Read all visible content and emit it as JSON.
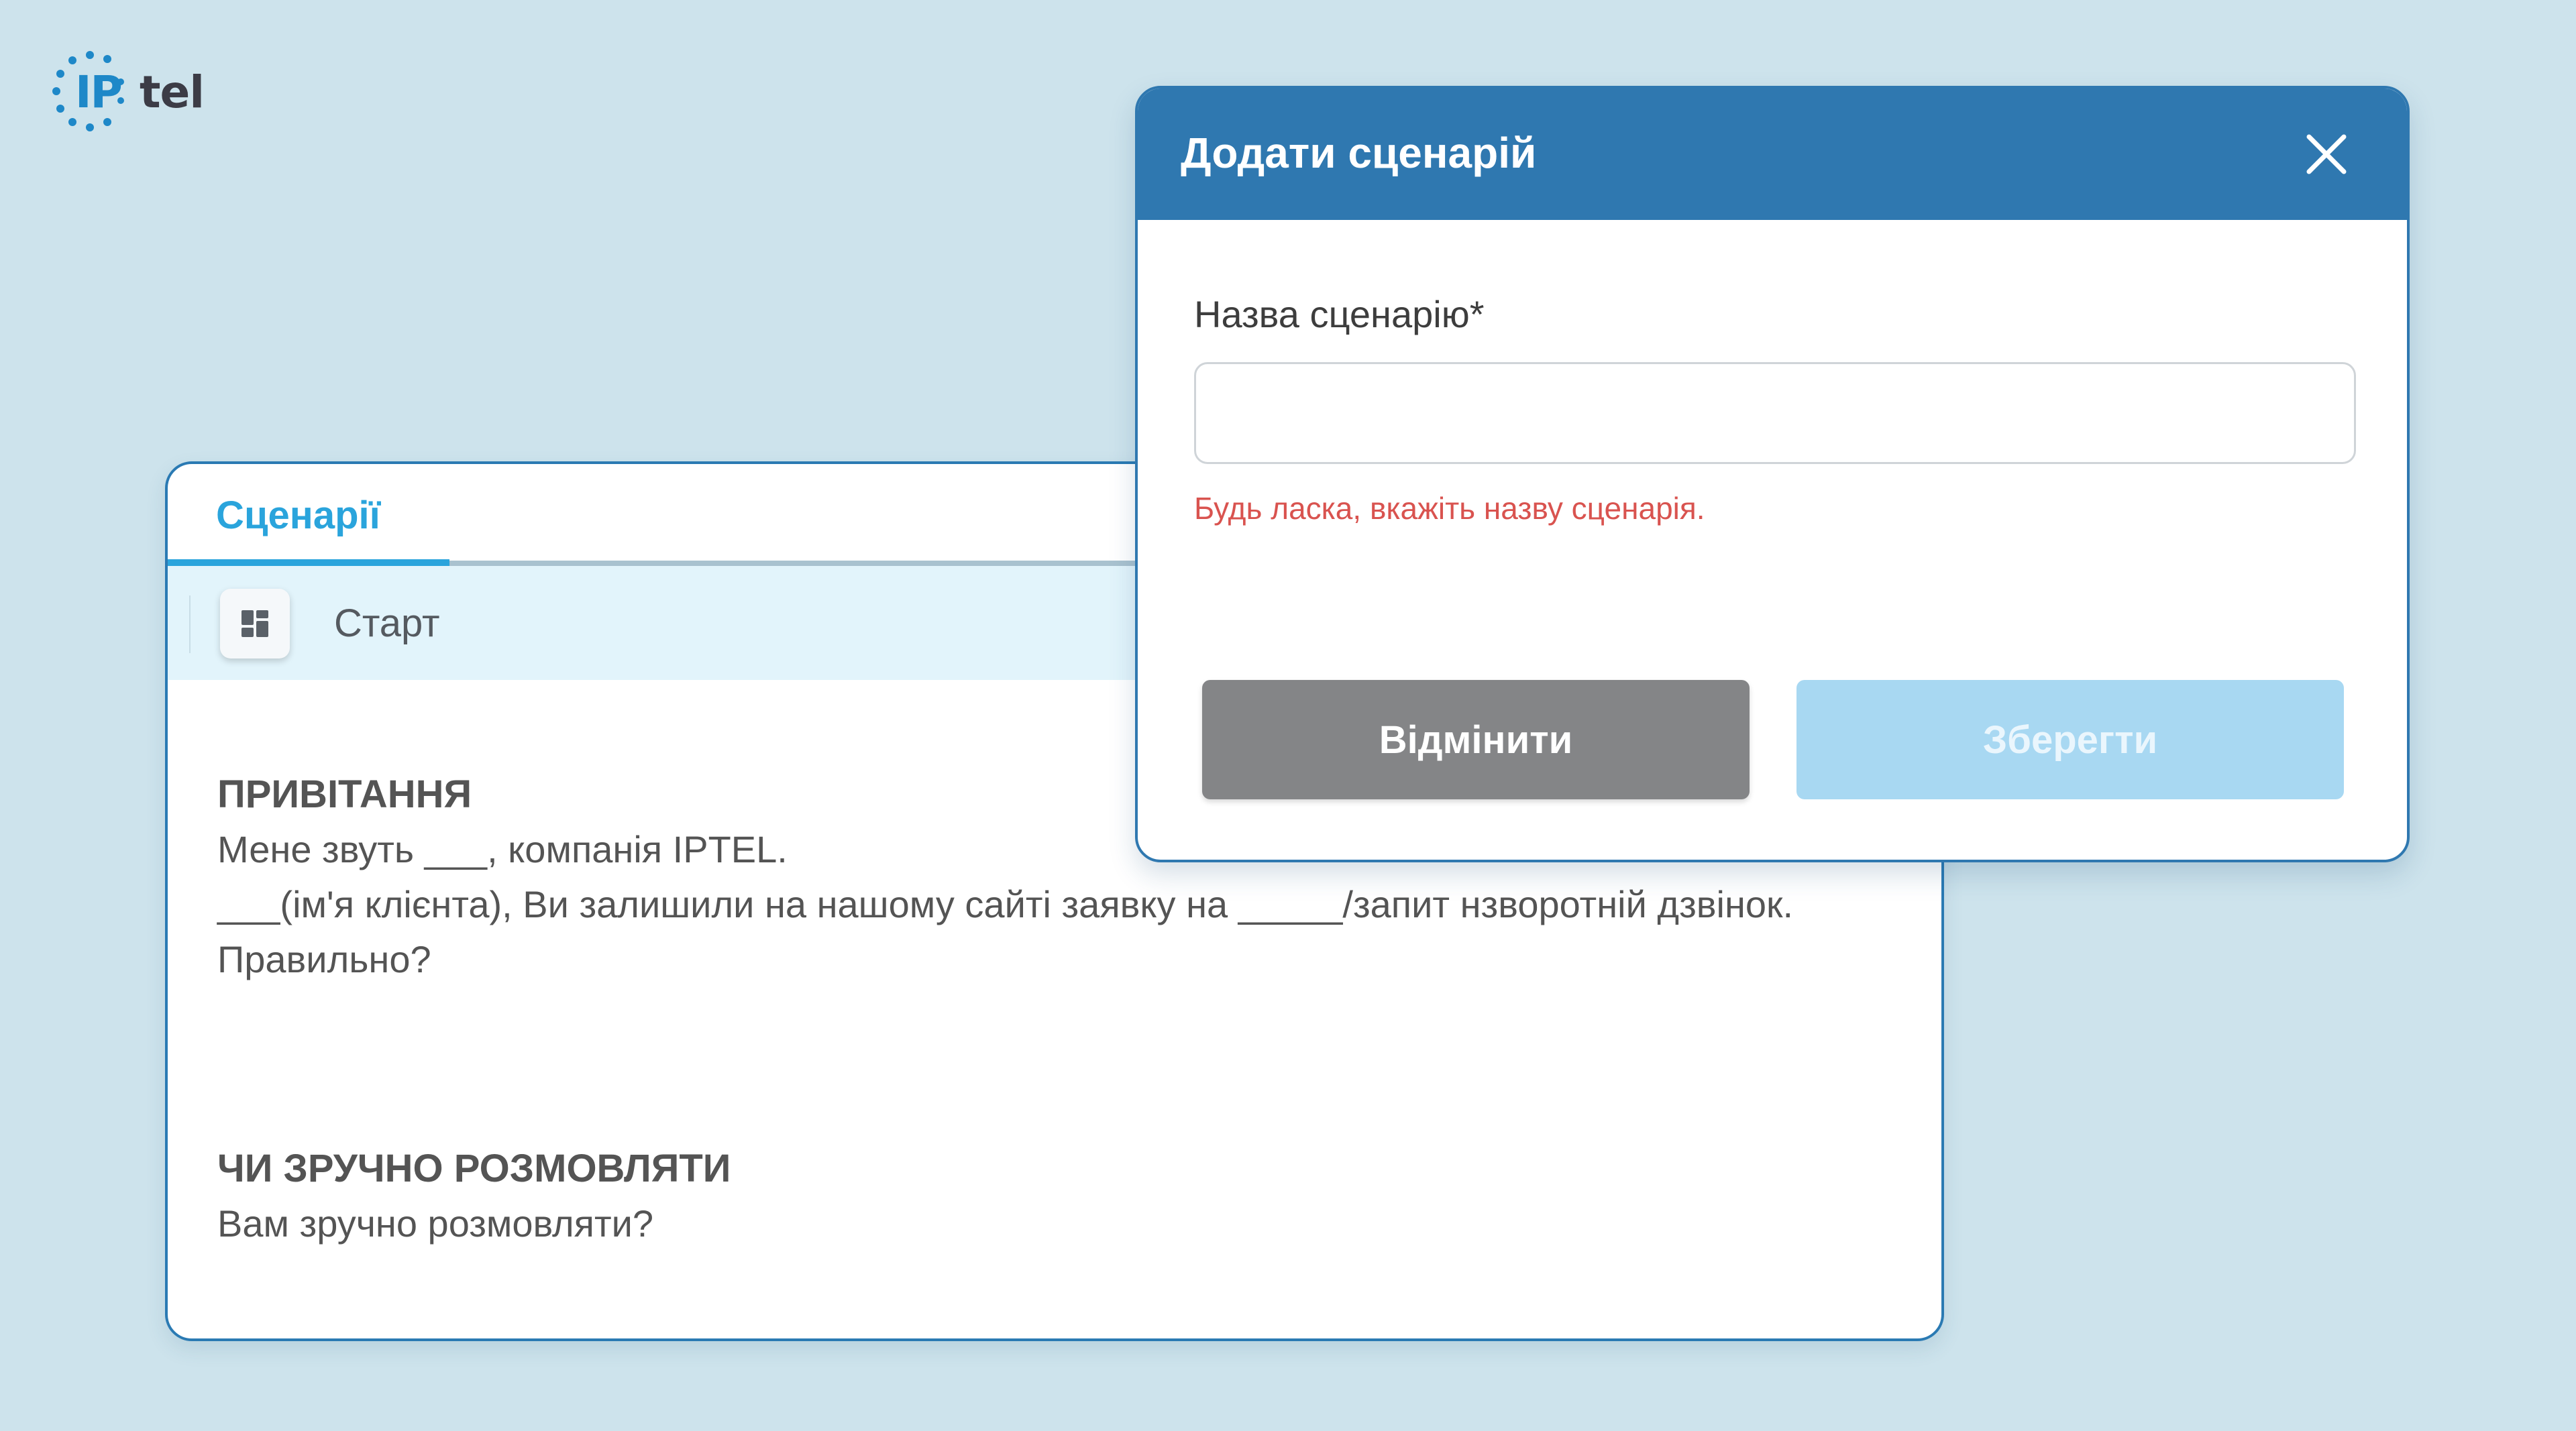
{
  "logo": {
    "ip": "IP",
    "tel": "tel"
  },
  "scripts_panel": {
    "tab_label": "Сценарії",
    "start_label": "Старт",
    "sections": [
      {
        "title": "ПРИВІТАННЯ",
        "lines": [
          "Мене звуть ___, компанія IPTEL.",
          "___(ім'я клієнта), Ви залишили на нашому сайті заявку на _____/запит нзворотній дзвінок.",
          "Правильно?"
        ]
      },
      {
        "title": "ЧИ ЗРУЧНО РОЗМОВЛЯТИ",
        "lines": [
          "Вам зручно розмовляти?"
        ]
      }
    ]
  },
  "dialog": {
    "title": "Додати сценарій",
    "field_label": "Назва сценарію*",
    "field_value": "",
    "error_text": "Будь ласка, вкажіть назву сценарія.",
    "cancel_label": "Відмінити",
    "save_label": "Зберегти"
  },
  "icons": {
    "close": "close-icon",
    "start": "dashboard-icon"
  },
  "colors": {
    "background": "#cde3ec",
    "accent": "#2f78b0",
    "tab_active": "#2aa4dc",
    "error": "#d9534f",
    "cancel_button": "#848587",
    "save_button_disabled": "#a8d8f2"
  }
}
